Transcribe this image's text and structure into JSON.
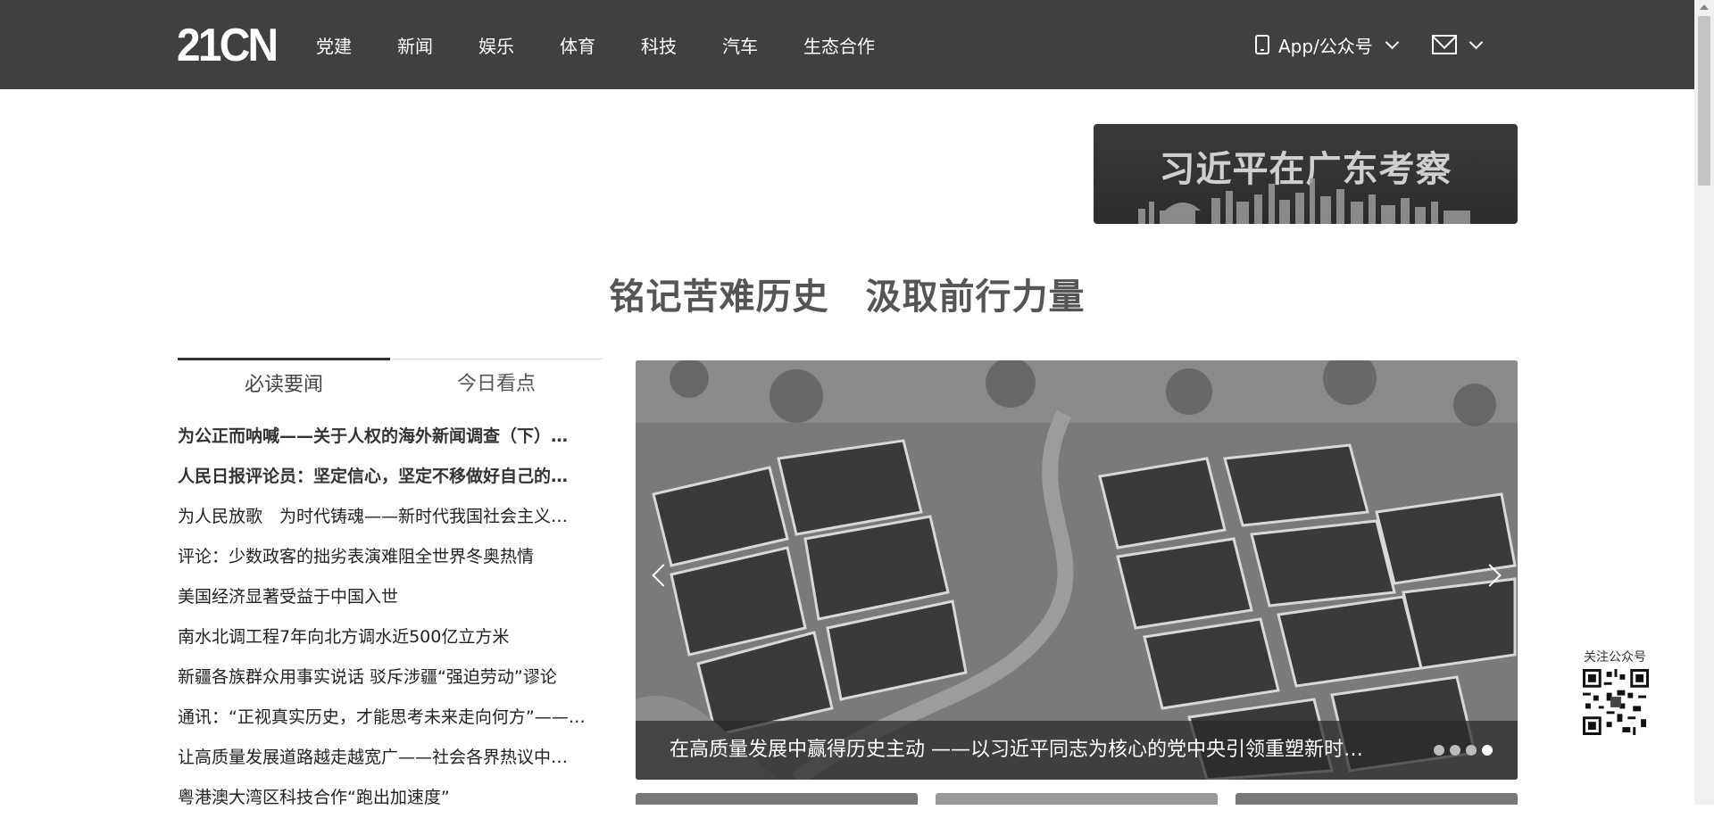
{
  "header": {
    "logo": "21CN",
    "nav": [
      "党建",
      "新闻",
      "娱乐",
      "体育",
      "科技",
      "汽车",
      "生态合作"
    ],
    "app_label": "App/公众号"
  },
  "banner": {
    "text": "习近平在广东考察"
  },
  "headline": "铭记苦难历史　汲取前行力量",
  "tabs": [
    {
      "label": "必读要闻",
      "active": true
    },
    {
      "label": "今日看点",
      "active": false
    }
  ],
  "news": [
    {
      "title": "为公正而呐喊——关于人权的海外新闻调查（下）…",
      "bold": true
    },
    {
      "title": "人民日报评论员：坚定信心，坚定不移做好自己的…",
      "bold": true
    },
    {
      "title": "为人民放歌　为时代铸魂——新时代我国社会主义…",
      "bold": false
    },
    {
      "title": "评论：少数政客的拙劣表演难阻全世界冬奥热情",
      "bold": false
    },
    {
      "title": "美国经济显著受益于中国入世",
      "bold": false
    },
    {
      "title": "南水北调工程7年向北方调水近500亿立方米",
      "bold": false
    },
    {
      "title": "新疆各族群众用事实说话 驳斥涉疆“强迫劳动”谬论",
      "bold": false
    },
    {
      "title": "通讯：“正视真实历史，才能思考未来走向何方”——…",
      "bold": false
    },
    {
      "title": "让高质量发展道路越走越宽广——社会各界热议中…",
      "bold": false
    },
    {
      "title": "粤港澳大湾区科技合作“跑出加速度”",
      "bold": false
    }
  ],
  "carousel": {
    "caption": "在高质量发展中赢得历史主动 ——以习近平同志为核心的党中央引领重塑新时…",
    "dot_count": 4,
    "active_dot": 4
  },
  "follow": {
    "label": "关注公众号"
  }
}
